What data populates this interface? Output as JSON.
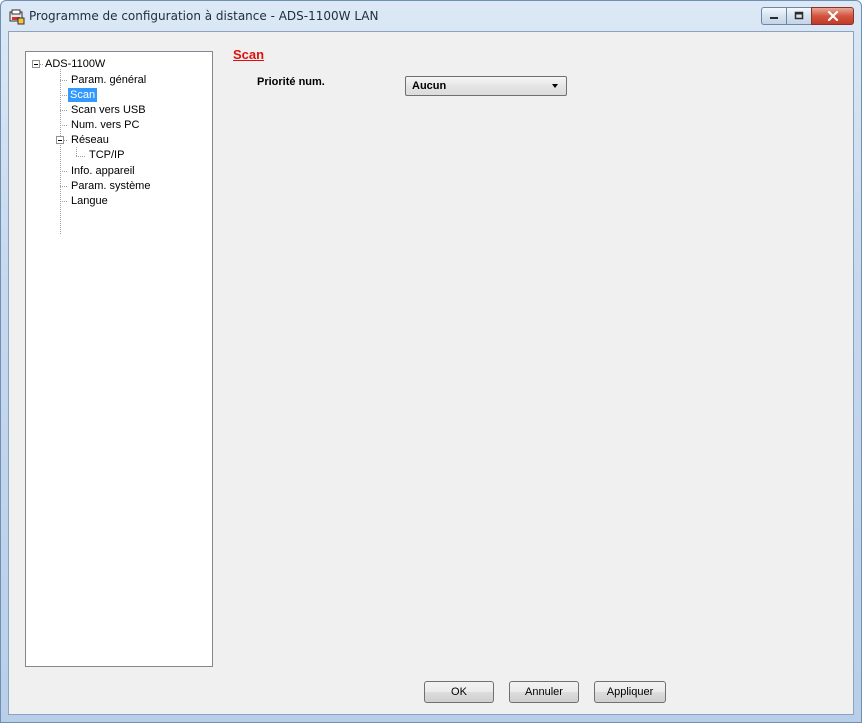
{
  "window": {
    "title": "Programme de configuration à distance - ADS-1100W LAN"
  },
  "tree": {
    "root": "ADS-1100W",
    "items": [
      {
        "label": "Param. général"
      },
      {
        "label": "Scan",
        "selected": true
      },
      {
        "label": "Scan vers USB"
      },
      {
        "label": "Num. vers PC"
      },
      {
        "label": "Réseau",
        "expanded": true
      },
      {
        "label": "TCP/IP"
      },
      {
        "label": "Info. appareil"
      },
      {
        "label": "Param. système"
      },
      {
        "label": "Langue"
      }
    ]
  },
  "content": {
    "section_title": "Scan",
    "field_label": "Priorité num.",
    "field_value": "Aucun"
  },
  "buttons": {
    "ok": "OK",
    "cancel": "Annuler",
    "apply": "Appliquer"
  },
  "colors": {
    "section_title": "#e01010",
    "selection": "#3399ff"
  }
}
